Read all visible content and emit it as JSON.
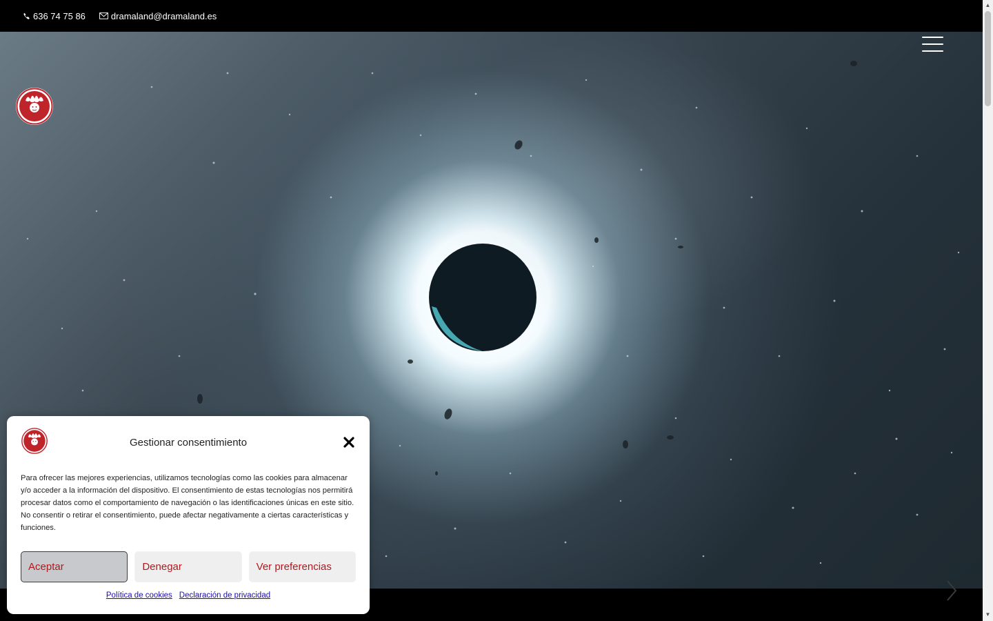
{
  "topbar": {
    "phone": "636 74 75 86",
    "email": "dramaland@dramaland.es",
    "phone_icon": "phone-icon",
    "email_icon": "envelope-icon"
  },
  "header": {
    "logo": "dramaland-logo",
    "menu_icon": "hamburger-menu-icon"
  },
  "hero": {
    "image": "solar-eclipse-background",
    "next_arrow_icon": "chevron-right-icon"
  },
  "consent": {
    "title": "Gestionar consentimiento",
    "close_icon": "close-icon",
    "text": "Para ofrecer las mejores experiencias, utilizamos tecnologías como las cookies para almacenar y/o acceder a la información del dispositivo. El consentimiento de estas tecnologías nos permitirá procesar datos como el comportamiento de navegación o las identificaciones únicas en este sitio. No consentir o retirar el consentimiento, puede afectar negativamente a ciertas características y funciones.",
    "buttons": {
      "accept": "Aceptar",
      "deny": "Denegar",
      "preferences": "Ver preferencias"
    },
    "links": {
      "cookie_policy": "Política de cookies",
      "privacy": "Declaración de privacidad"
    }
  },
  "colors": {
    "accent": "#b0191e",
    "link": "#1a0dab",
    "topbar_bg": "#000000"
  }
}
